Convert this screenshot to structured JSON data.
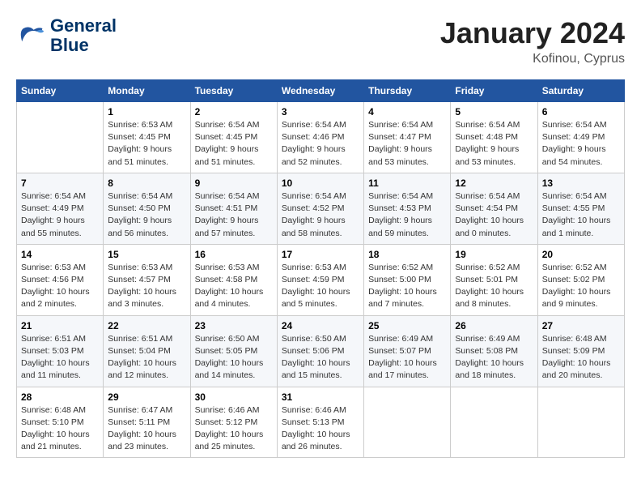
{
  "logo": {
    "line1": "General",
    "line2": "Blue"
  },
  "title": "January 2024",
  "location": "Kofinou, Cyprus",
  "days_of_week": [
    "Sunday",
    "Monday",
    "Tuesday",
    "Wednesday",
    "Thursday",
    "Friday",
    "Saturday"
  ],
  "weeks": [
    [
      {
        "num": "",
        "info": ""
      },
      {
        "num": "1",
        "info": "Sunrise: 6:53 AM\nSunset: 4:45 PM\nDaylight: 9 hours\nand 51 minutes."
      },
      {
        "num": "2",
        "info": "Sunrise: 6:54 AM\nSunset: 4:45 PM\nDaylight: 9 hours\nand 51 minutes."
      },
      {
        "num": "3",
        "info": "Sunrise: 6:54 AM\nSunset: 4:46 PM\nDaylight: 9 hours\nand 52 minutes."
      },
      {
        "num": "4",
        "info": "Sunrise: 6:54 AM\nSunset: 4:47 PM\nDaylight: 9 hours\nand 53 minutes."
      },
      {
        "num": "5",
        "info": "Sunrise: 6:54 AM\nSunset: 4:48 PM\nDaylight: 9 hours\nand 53 minutes."
      },
      {
        "num": "6",
        "info": "Sunrise: 6:54 AM\nSunset: 4:49 PM\nDaylight: 9 hours\nand 54 minutes."
      }
    ],
    [
      {
        "num": "7",
        "info": "Sunrise: 6:54 AM\nSunset: 4:49 PM\nDaylight: 9 hours\nand 55 minutes."
      },
      {
        "num": "8",
        "info": "Sunrise: 6:54 AM\nSunset: 4:50 PM\nDaylight: 9 hours\nand 56 minutes."
      },
      {
        "num": "9",
        "info": "Sunrise: 6:54 AM\nSunset: 4:51 PM\nDaylight: 9 hours\nand 57 minutes."
      },
      {
        "num": "10",
        "info": "Sunrise: 6:54 AM\nSunset: 4:52 PM\nDaylight: 9 hours\nand 58 minutes."
      },
      {
        "num": "11",
        "info": "Sunrise: 6:54 AM\nSunset: 4:53 PM\nDaylight: 9 hours\nand 59 minutes."
      },
      {
        "num": "12",
        "info": "Sunrise: 6:54 AM\nSunset: 4:54 PM\nDaylight: 10 hours\nand 0 minutes."
      },
      {
        "num": "13",
        "info": "Sunrise: 6:54 AM\nSunset: 4:55 PM\nDaylight: 10 hours\nand 1 minute."
      }
    ],
    [
      {
        "num": "14",
        "info": "Sunrise: 6:53 AM\nSunset: 4:56 PM\nDaylight: 10 hours\nand 2 minutes."
      },
      {
        "num": "15",
        "info": "Sunrise: 6:53 AM\nSunset: 4:57 PM\nDaylight: 10 hours\nand 3 minutes."
      },
      {
        "num": "16",
        "info": "Sunrise: 6:53 AM\nSunset: 4:58 PM\nDaylight: 10 hours\nand 4 minutes."
      },
      {
        "num": "17",
        "info": "Sunrise: 6:53 AM\nSunset: 4:59 PM\nDaylight: 10 hours\nand 5 minutes."
      },
      {
        "num": "18",
        "info": "Sunrise: 6:52 AM\nSunset: 5:00 PM\nDaylight: 10 hours\nand 7 minutes."
      },
      {
        "num": "19",
        "info": "Sunrise: 6:52 AM\nSunset: 5:01 PM\nDaylight: 10 hours\nand 8 minutes."
      },
      {
        "num": "20",
        "info": "Sunrise: 6:52 AM\nSunset: 5:02 PM\nDaylight: 10 hours\nand 9 minutes."
      }
    ],
    [
      {
        "num": "21",
        "info": "Sunrise: 6:51 AM\nSunset: 5:03 PM\nDaylight: 10 hours\nand 11 minutes."
      },
      {
        "num": "22",
        "info": "Sunrise: 6:51 AM\nSunset: 5:04 PM\nDaylight: 10 hours\nand 12 minutes."
      },
      {
        "num": "23",
        "info": "Sunrise: 6:50 AM\nSunset: 5:05 PM\nDaylight: 10 hours\nand 14 minutes."
      },
      {
        "num": "24",
        "info": "Sunrise: 6:50 AM\nSunset: 5:06 PM\nDaylight: 10 hours\nand 15 minutes."
      },
      {
        "num": "25",
        "info": "Sunrise: 6:49 AM\nSunset: 5:07 PM\nDaylight: 10 hours\nand 17 minutes."
      },
      {
        "num": "26",
        "info": "Sunrise: 6:49 AM\nSunset: 5:08 PM\nDaylight: 10 hours\nand 18 minutes."
      },
      {
        "num": "27",
        "info": "Sunrise: 6:48 AM\nSunset: 5:09 PM\nDaylight: 10 hours\nand 20 minutes."
      }
    ],
    [
      {
        "num": "28",
        "info": "Sunrise: 6:48 AM\nSunset: 5:10 PM\nDaylight: 10 hours\nand 21 minutes."
      },
      {
        "num": "29",
        "info": "Sunrise: 6:47 AM\nSunset: 5:11 PM\nDaylight: 10 hours\nand 23 minutes."
      },
      {
        "num": "30",
        "info": "Sunrise: 6:46 AM\nSunset: 5:12 PM\nDaylight: 10 hours\nand 25 minutes."
      },
      {
        "num": "31",
        "info": "Sunrise: 6:46 AM\nSunset: 5:13 PM\nDaylight: 10 hours\nand 26 minutes."
      },
      {
        "num": "",
        "info": ""
      },
      {
        "num": "",
        "info": ""
      },
      {
        "num": "",
        "info": ""
      }
    ]
  ]
}
